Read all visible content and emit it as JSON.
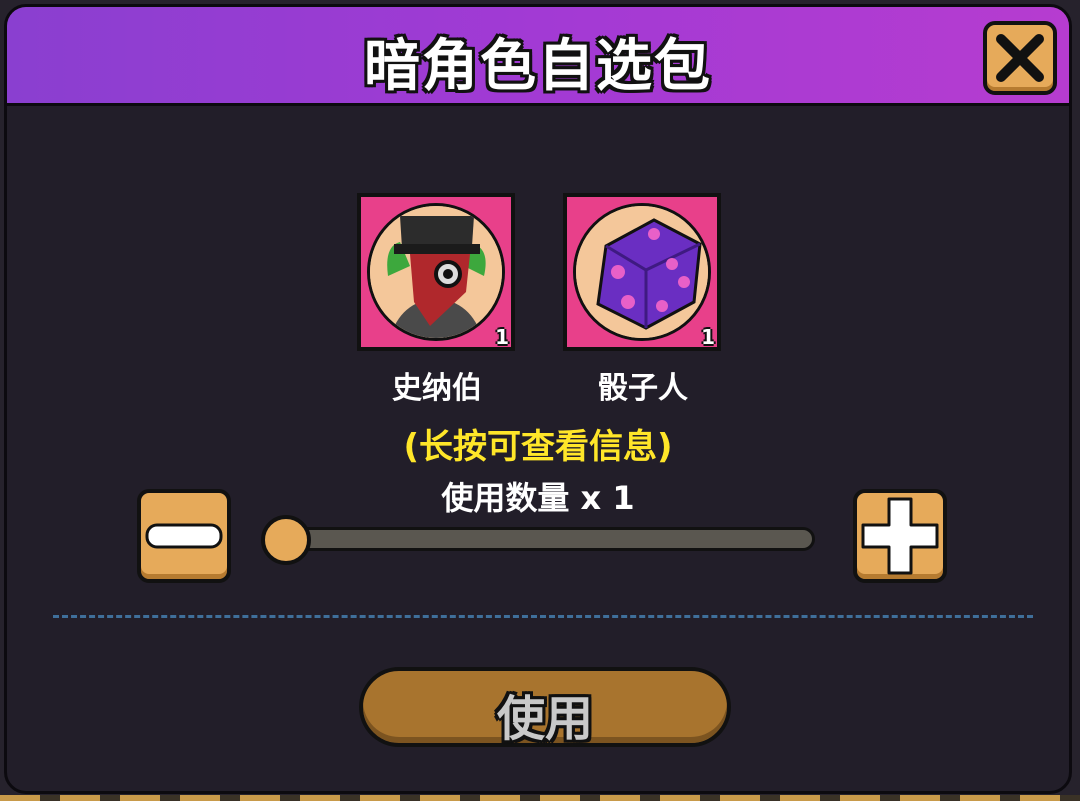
{
  "dialog": {
    "title": "暗角色自选包",
    "close_icon": "close-x-icon"
  },
  "characters": [
    {
      "name": "史纳伯",
      "count": "1",
      "icon": "plague-doctor-portrait"
    },
    {
      "name": "骰子人",
      "count": "1",
      "icon": "purple-dice-portrait"
    }
  ],
  "hint": "(长按可查看信息)",
  "quantity": {
    "label": "使用数量 x 1",
    "value": 1,
    "decrease_icon": "minus-icon",
    "increase_icon": "plus-icon"
  },
  "use_button": {
    "label": "使用"
  },
  "colors": {
    "title_bar": "#a23ad4",
    "panel": "#221e29",
    "accent_orange": "#e6aa5a",
    "hint_yellow": "#ffe629",
    "card_pink": "#e8408a",
    "use_button": "#a8742e"
  }
}
